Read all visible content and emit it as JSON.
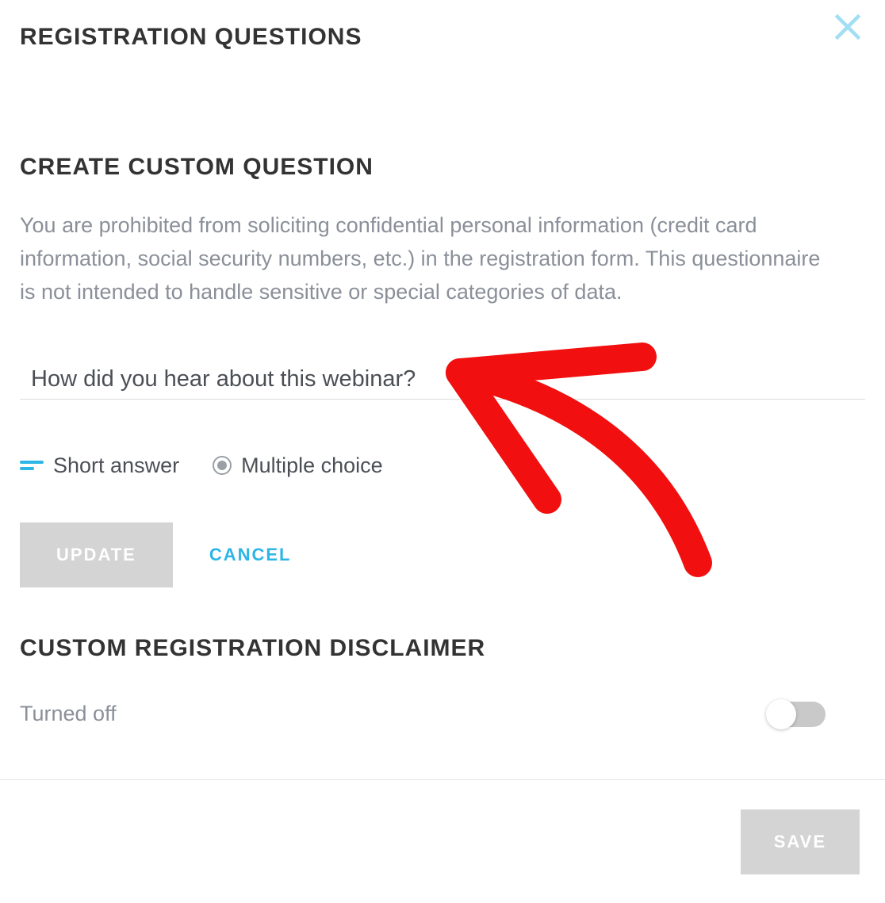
{
  "modal": {
    "title": "REGISTRATION QUESTIONS"
  },
  "create": {
    "title": "CREATE CUSTOM QUESTION",
    "disclaimer": "You are prohibited from soliciting confidential personal information (credit card information, social security numbers, etc.) in the registration form. This questionnaire is not intended to handle sensitive or special categories of data.",
    "question_value": "How did you hear about this webinar?",
    "answer_types": {
      "short": "Short answer",
      "multiple": "Multiple choice"
    },
    "buttons": {
      "update": "UPDATE",
      "cancel": "CANCEL"
    }
  },
  "custom_disclaimer": {
    "title": "CUSTOM REGISTRATION DISCLAIMER",
    "status": "Turned off"
  },
  "footer": {
    "save": "SAVE"
  },
  "colors": {
    "accent": "#2bb6e6",
    "muted_btn": "#d4d4d4",
    "text_muted": "#8a8f99"
  }
}
